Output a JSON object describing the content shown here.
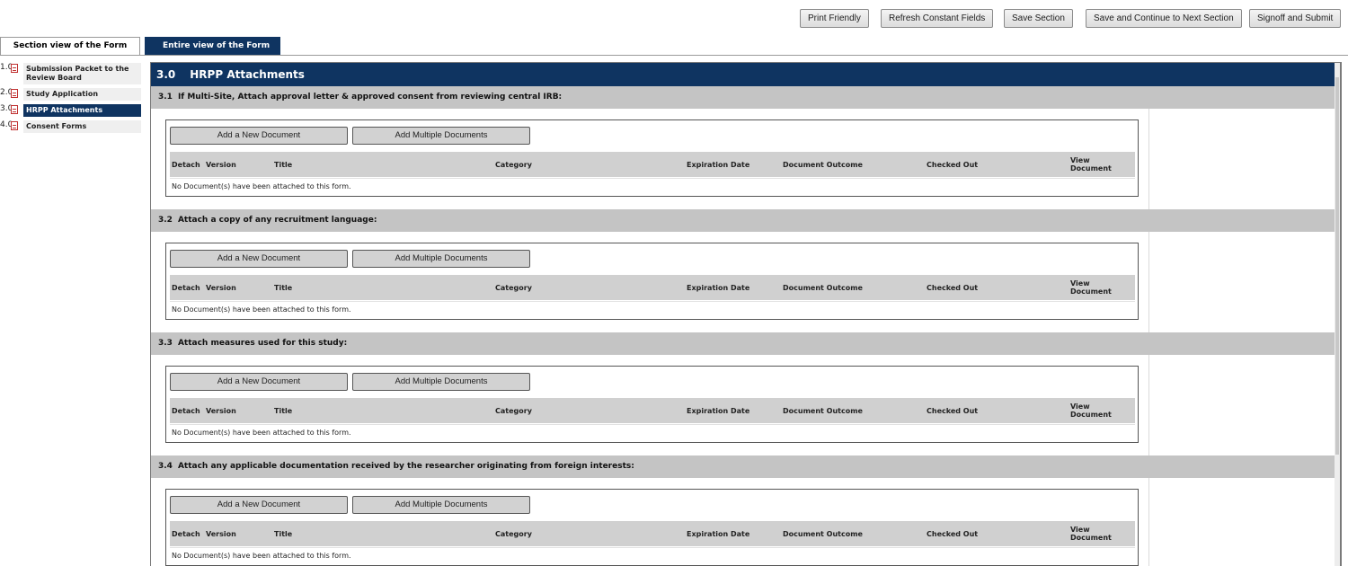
{
  "toolbar": {
    "print": "Print Friendly",
    "refresh": "Refresh Constant Fields",
    "save": "Save Section",
    "save_continue": "Save and Continue to Next Section",
    "signoff": "Signoff and Submit"
  },
  "tabs": {
    "section_view": "Section view of the Form",
    "entire_view": "Entire view of the Form"
  },
  "nav": {
    "items": [
      {
        "num": "1.0",
        "label": "Submission Packet to the Review Board",
        "active": false
      },
      {
        "num": "2.0",
        "label": "Study Application",
        "active": false
      },
      {
        "num": "3.0",
        "label": "HRPP Attachments",
        "active": true
      },
      {
        "num": "4.0",
        "label": "Consent Forms",
        "active": false
      }
    ]
  },
  "section": {
    "num": "3.0",
    "title": "HRPP Attachments"
  },
  "columns": [
    "Detach",
    "Version",
    "Title",
    "Category",
    "Expiration Date",
    "Document Outcome",
    "Checked Out",
    "View Document"
  ],
  "buttons": {
    "add_new": "Add a New Document",
    "add_multiple": "Add Multiple Documents"
  },
  "empty_message": "No Document(s) have been attached to this form.",
  "questions": [
    {
      "num": "3.1",
      "text": "If Multi-Site, Attach approval letter & approved consent from reviewing central IRB:"
    },
    {
      "num": "3.2",
      "text": "Attach a copy of any recruitment language:"
    },
    {
      "num": "3.3",
      "text": "Attach measures used for this study:"
    },
    {
      "num": "3.4",
      "text": "Attach any applicable documentation received by the researcher originating from foreign interests:"
    }
  ]
}
